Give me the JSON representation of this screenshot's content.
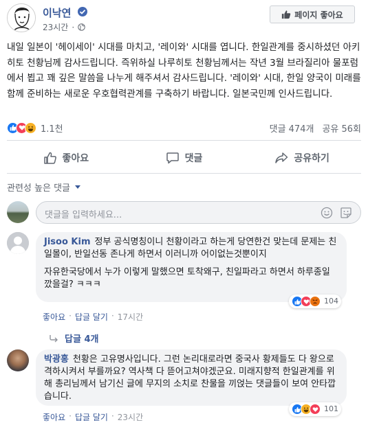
{
  "post": {
    "author": "이낙연",
    "time": "23시간",
    "like_page_label": "페이지 좋아요",
    "text": "내일 일본이 '헤이세이' 시대를 마치고, '레이와' 시대를 엽니다. 한일관계를 중시하셨던 아키히토 천황님께 감사드립니다. 즉위하실 나루히토 천황님께서는 작년 3월 브라질리아 물포럼에서 뵙고 꽤 깊은 말씀을 나누게 해주셔서 감사드립니다. '레이와' 시대, 한일 양국이 미래를 함께 준비하는 새로운 우호협력관계를 구축하기 바랍니다. 일본국민께 인사드립니다.",
    "reaction_count": "1.1천",
    "comments_count": "댓글 474개",
    "shares_count": "공유 56회"
  },
  "actions": {
    "like": "좋아요",
    "comment": "댓글",
    "share": "공유하기"
  },
  "sort_label": "관련성 높은 댓글",
  "composer": {
    "placeholder": "댓글을 입력하세요..."
  },
  "comments": [
    {
      "name": "Jisoo Kim",
      "text": "정부 공식명칭이니 천황이라고 하는게 당연한건 맞는데 문제는 친일몰이, 반일선동 존나게 하면서 이러니까 어이없는것뿐이지",
      "text2": "자유한국당에서 누가 이렇게 말했으면 토착왜구, 친일파라고 하면서 하루종일 깠을걸? ㅋㅋㅋ",
      "reactions": "104",
      "like": "좋아요",
      "reply": "답글 달기",
      "time": "17시간",
      "replies": "답글 4개"
    },
    {
      "name": "박광홍",
      "text": "천황은 고유명사입니다. 그런 논리대로라면 중국사 황제들도 다 왕으로 격하시켜서 부를까요? 역사책 다 뜯어고쳐야겠군요. 미래지향적 한일관계를 위해 총리님께서 남기신 글에 무지의 소치로 찬물을 끼얹는 댓글들이 보여 안타깝습니다.",
      "reactions": "101",
      "like": "좋아요",
      "reply": "답글 달기",
      "time": "23시간"
    }
  ],
  "colors": {
    "link": "#385898",
    "like_blue": "#1877f2",
    "love_red": "#f33e58",
    "haha_yellow": "#f7b125",
    "angry_orange": "#e9710f"
  }
}
